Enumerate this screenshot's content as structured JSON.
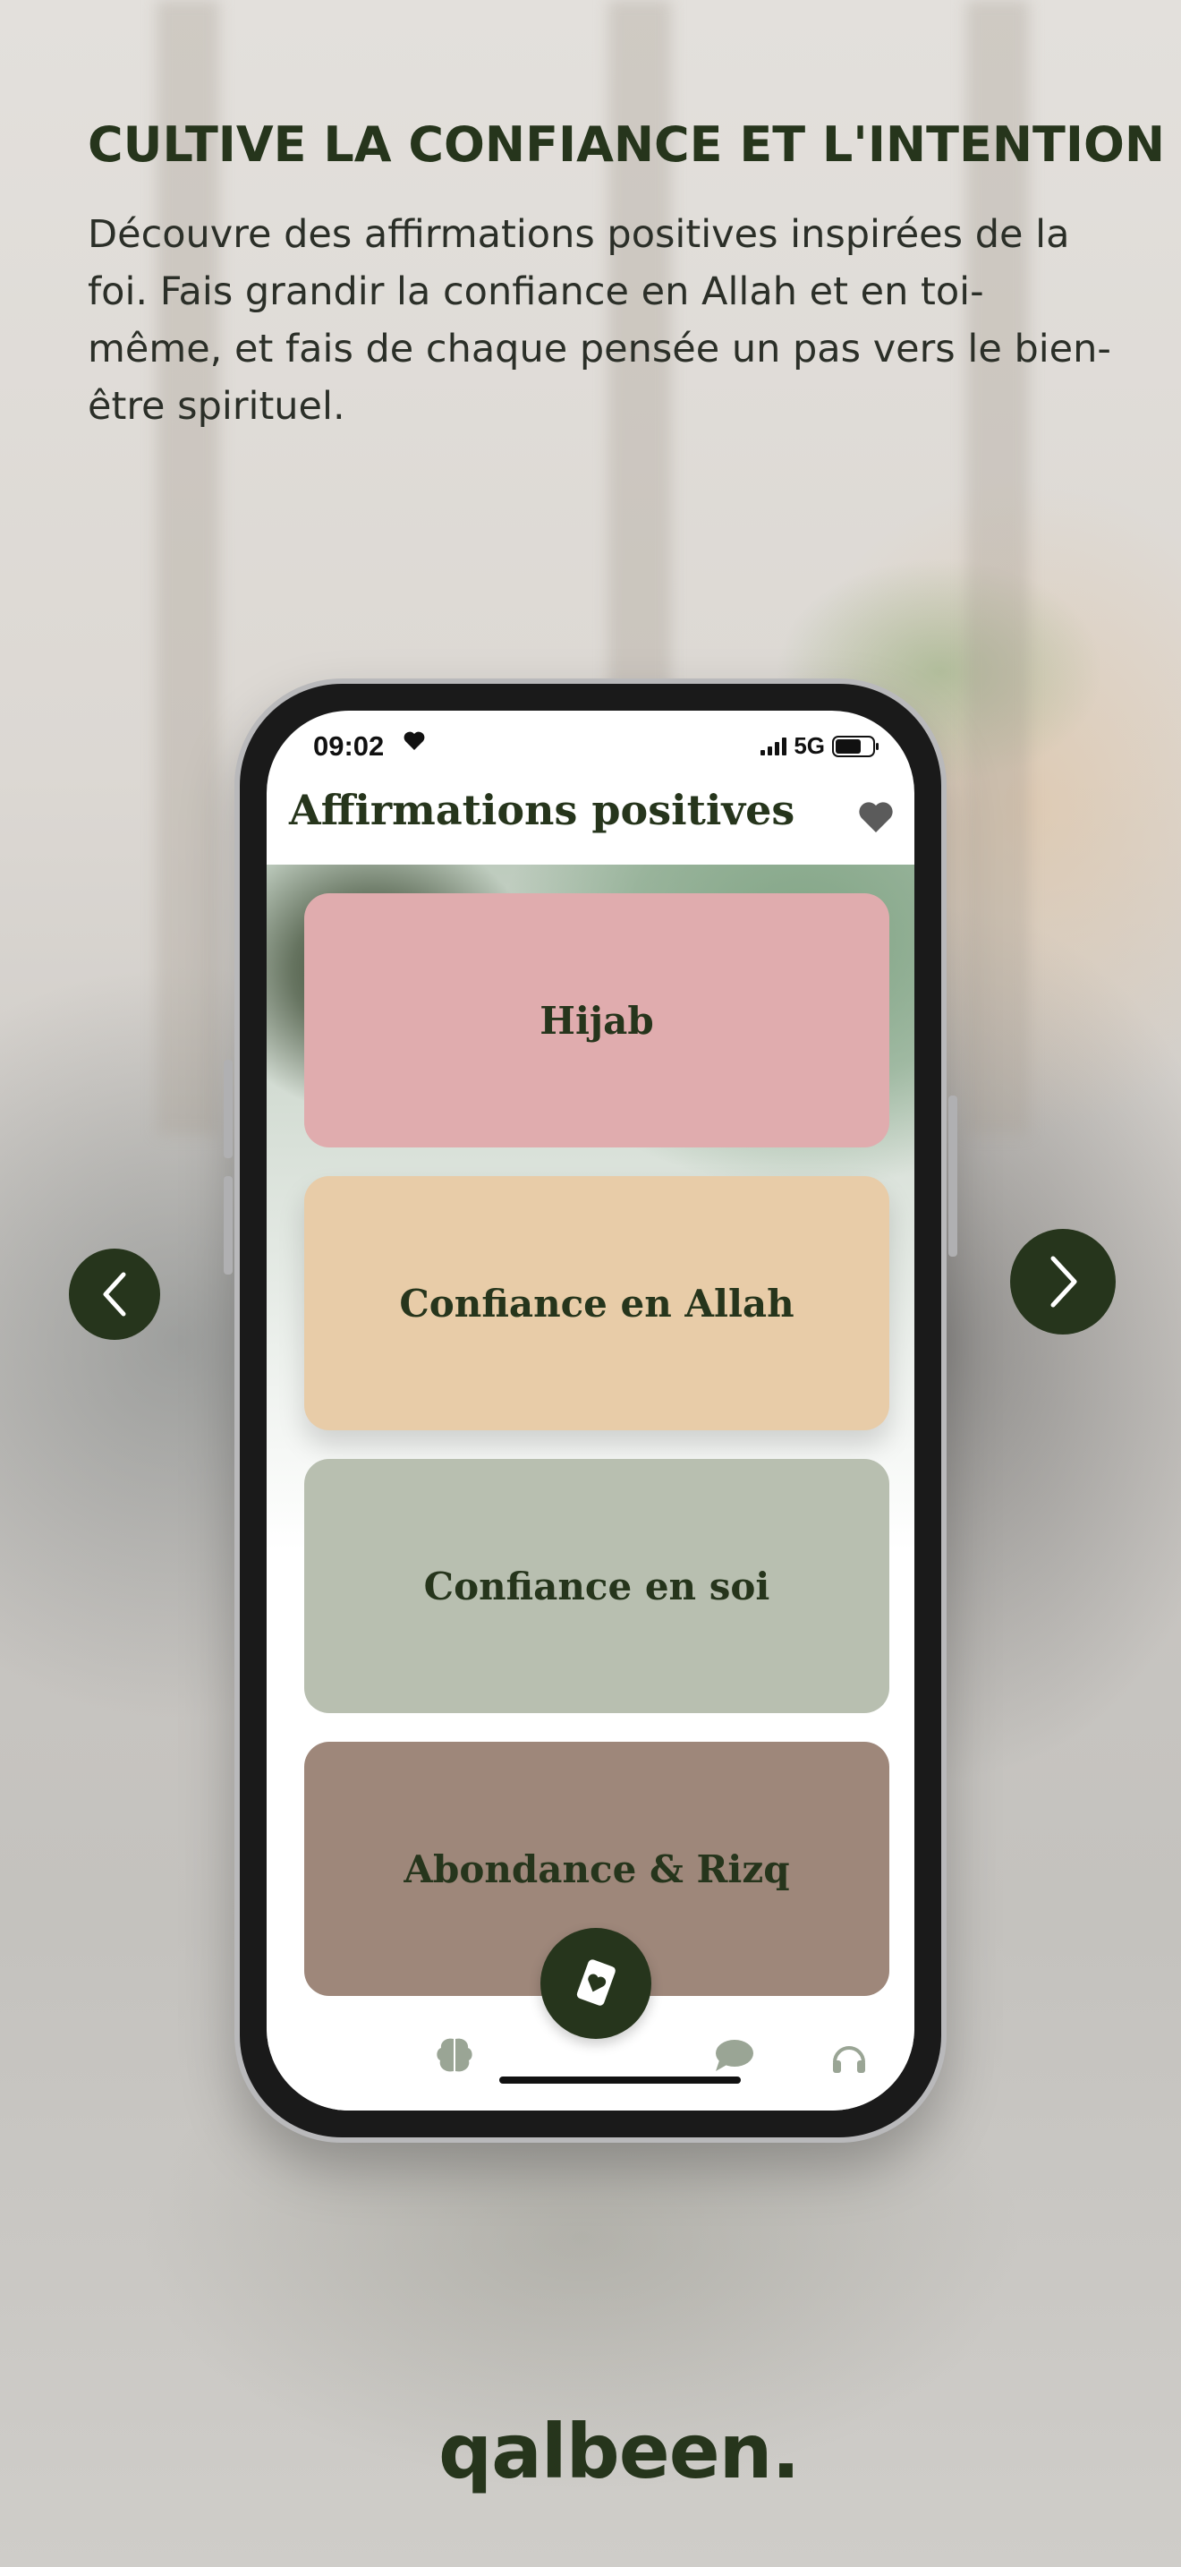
{
  "header": {
    "headline": "CULTIVE LA CONFIANCE ET L'INTENTION",
    "subtext": "Découvre des affirmations positives inspirées de la foi. Fais grandir la confiance en Allah et en toi-même, et fais de chaque pensée un pas vers le bien-être spirituel."
  },
  "status_bar": {
    "time": "09:02",
    "network": "5G"
  },
  "app": {
    "title": "Affirmations positives",
    "categories": [
      {
        "label": "Hijab",
        "color": "#e0acae"
      },
      {
        "label": "Confiance en Allah",
        "color": "#e8cca8"
      },
      {
        "label": "Confiance en soi",
        "color": "#b8bfb0"
      },
      {
        "label": "Abondance & Rizq",
        "color": "#9e877a"
      }
    ],
    "tabbar": {
      "tabs": [
        "moon-icon",
        "brain-icon",
        "card-icon",
        "chat-icon",
        "headphones-icon"
      ],
      "active_color": "#b7cf5f",
      "inactive_color": "#9aa595"
    }
  },
  "brand": {
    "logo": "qalbeen.",
    "primary_color": "#26351c"
  },
  "navigation": {
    "previous": "chevron-left-icon",
    "next": "chevron-right-icon"
  }
}
